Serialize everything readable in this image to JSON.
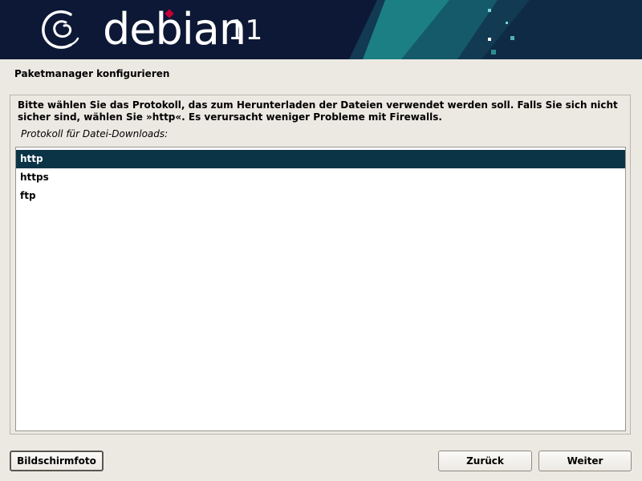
{
  "banner": {
    "logo_text": "debian",
    "version": "11",
    "logo_icon": "debian-swirl-icon",
    "colors": {
      "background": "#0d1836",
      "accent_teal": "#1b7f83",
      "accent_red": "#c70036"
    }
  },
  "page": {
    "title": "Paketmanager konfigurieren"
  },
  "question": {
    "instruction": "Bitte wählen Sie das Protokoll, das zum Herunterladen der Dateien verwendet werden soll. Falls Sie sich nicht sicher sind, wählen Sie »http«. Es verursacht weniger Probleme mit Firewalls.",
    "list_caption": "Protokoll für Datei-Downloads:",
    "options": [
      {
        "label": "http",
        "selected": true
      },
      {
        "label": "https",
        "selected": false
      },
      {
        "label": "ftp",
        "selected": false
      }
    ],
    "selection_color": "#0b3447"
  },
  "buttons": {
    "screenshot": "Bildschirmfoto",
    "back": "Zurück",
    "next": "Weiter"
  }
}
